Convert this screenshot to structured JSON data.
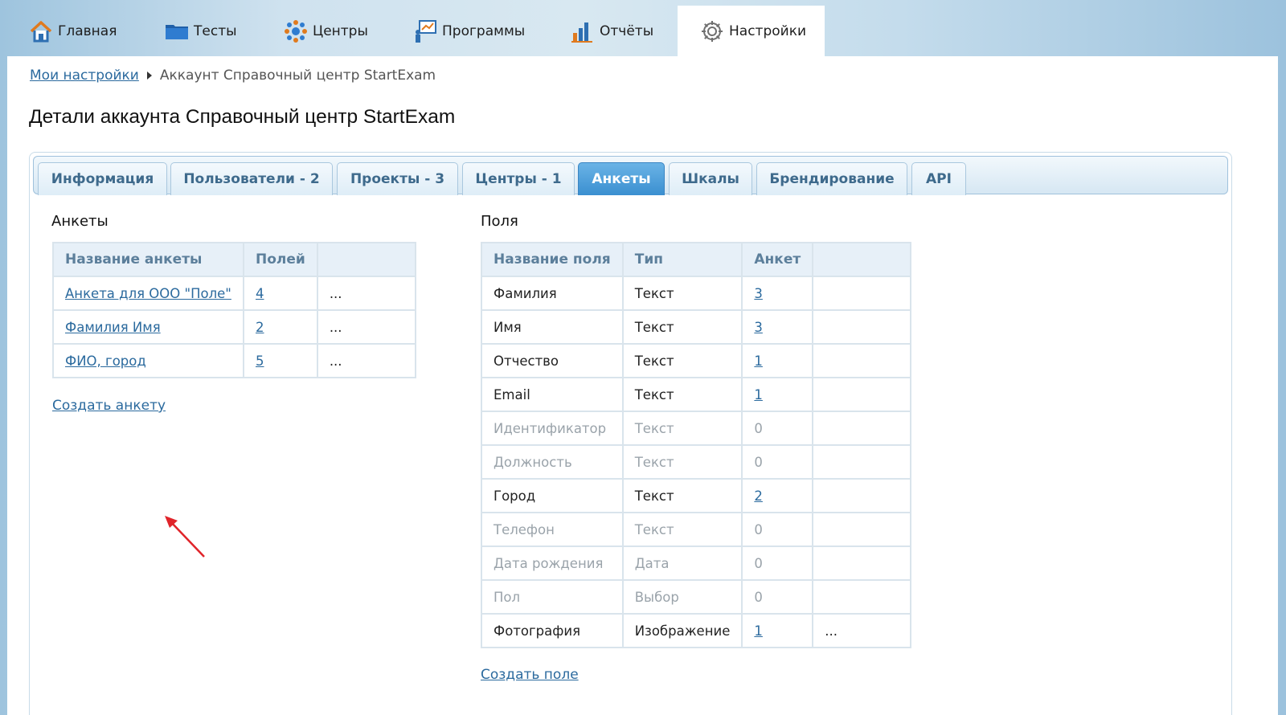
{
  "nav": [
    {
      "label": "Главная",
      "icon": "home-icon"
    },
    {
      "label": "Тесты",
      "icon": "folder-icon"
    },
    {
      "label": "Центры",
      "icon": "centers-icon"
    },
    {
      "label": "Программы",
      "icon": "programs-icon"
    },
    {
      "label": "Отчёты",
      "icon": "reports-icon"
    },
    {
      "label": "Настройки",
      "icon": "gear-icon",
      "active": true
    }
  ],
  "breadcrumb": {
    "link": "Мои настройки",
    "current": "Аккаунт Справочный центр StartExam"
  },
  "page_title": "Детали аккаунта Справочный центр StartExam",
  "tabs": [
    {
      "label": "Информация"
    },
    {
      "label": "Пользователи - 2"
    },
    {
      "label": "Проекты - 3"
    },
    {
      "label": "Центры - 1"
    },
    {
      "label": "Анкеты",
      "active": true
    },
    {
      "label": "Шкалы"
    },
    {
      "label": "Брендирование"
    },
    {
      "label": "API"
    }
  ],
  "forms": {
    "title": "Анкеты",
    "headers": [
      "Название анкеты",
      "Полей",
      ""
    ],
    "rows": [
      {
        "name": "Анкета для ООО \"Поле\"",
        "fields": "4",
        "more": "..."
      },
      {
        "name": "Фамилия Имя",
        "fields": "2",
        "more": "..."
      },
      {
        "name": "ФИО, город",
        "fields": "5",
        "more": "..."
      }
    ],
    "create_link": "Создать анкету"
  },
  "fields": {
    "title": "Поля",
    "headers": [
      "Название поля",
      "Тип",
      "Анкет",
      ""
    ],
    "rows": [
      {
        "name": "Фамилия",
        "type": "Текст",
        "count": "3",
        "more": "",
        "muted": false
      },
      {
        "name": "Имя",
        "type": "Текст",
        "count": "3",
        "more": "",
        "muted": false
      },
      {
        "name": "Отчество",
        "type": "Текст",
        "count": "1",
        "more": "",
        "muted": false
      },
      {
        "name": "Email",
        "type": "Текст",
        "count": "1",
        "more": "",
        "muted": false
      },
      {
        "name": "Идентификатор",
        "type": "Текст",
        "count": "0",
        "more": "",
        "muted": true
      },
      {
        "name": "Должность",
        "type": "Текст",
        "count": "0",
        "more": "",
        "muted": true
      },
      {
        "name": "Город",
        "type": "Текст",
        "count": "2",
        "more": "",
        "muted": false
      },
      {
        "name": "Телефон",
        "type": "Текст",
        "count": "0",
        "more": "",
        "muted": true
      },
      {
        "name": "Дата рождения",
        "type": "Дата",
        "count": "0",
        "more": "",
        "muted": true
      },
      {
        "name": "Пол",
        "type": "Выбор",
        "count": "0",
        "more": "",
        "muted": true
      },
      {
        "name": "Фотография",
        "type": "Изображение",
        "count": "1",
        "more": "...",
        "muted": false
      }
    ],
    "create_link": "Создать поле"
  },
  "colors": {
    "link": "#2b6a9e",
    "tab_active": "#3a8fd0",
    "annotation_arrow": "#e0242a"
  }
}
